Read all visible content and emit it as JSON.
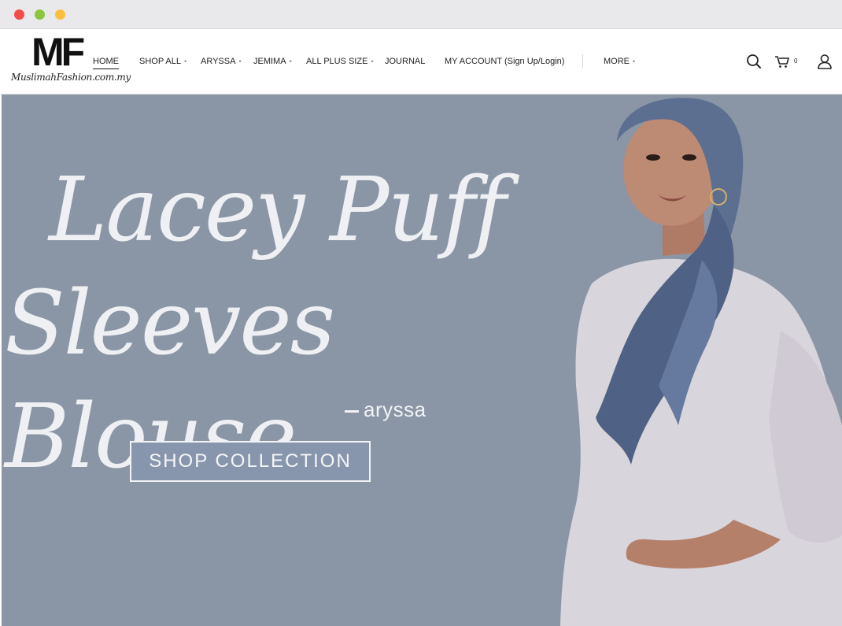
{
  "window": {
    "controls": [
      "close",
      "minimize",
      "maximize"
    ]
  },
  "logo": {
    "mark": "MF",
    "tagline": "MuslimahFashion.com.my"
  },
  "nav": {
    "home": "HOME",
    "shop_all": "SHOP ALL",
    "aryssa": "ARYSSA",
    "jemima": "JEMIMA",
    "plus_size": "ALL PLUS SIZE",
    "journal": "JOURNAL",
    "account": "MY ACCOUNT (Sign Up/Login)",
    "more": "MORE",
    "caret": "•"
  },
  "header_icons": {
    "search": "search-icon",
    "cart": "cart-icon",
    "account": "user-icon"
  },
  "cart": {
    "count": "0"
  },
  "hero": {
    "title_line1": "Lacey Puff",
    "title_line2": "Sleeves Blouse",
    "brand": "aryssa",
    "cta": "SHOP COLLECTION"
  },
  "colors": {
    "hero_bg": "#8a96a6",
    "scarf": "#5d6f91",
    "blouse": "#d9d5dc"
  }
}
